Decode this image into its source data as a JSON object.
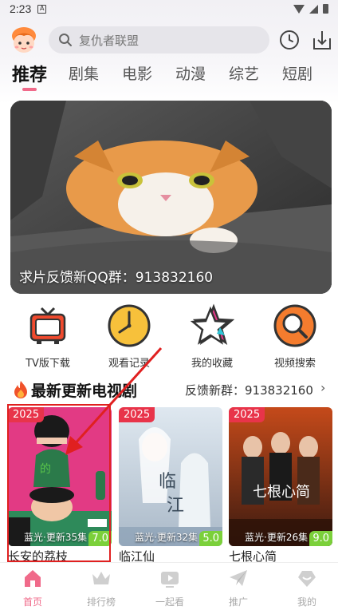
{
  "status_bar": {
    "time": "2:23",
    "notification_icon": "A"
  },
  "search": {
    "placeholder": "复仇者联盟"
  },
  "tabs": [
    {
      "label": "推荐",
      "active": true
    },
    {
      "label": "剧集"
    },
    {
      "label": "电影"
    },
    {
      "label": "动漫"
    },
    {
      "label": "综艺"
    },
    {
      "label": "短剧"
    }
  ],
  "banner": {
    "caption": "求片反馈新QQ群：913832160"
  },
  "shortcuts": [
    {
      "label": "TV版下载",
      "icon": "tv-icon"
    },
    {
      "label": "观看记录",
      "icon": "clock-icon"
    },
    {
      "label": "我的收藏",
      "icon": "star-icon"
    },
    {
      "label": "视频搜索",
      "icon": "magnifier-icon"
    }
  ],
  "section": {
    "title": "最新更新电视剧",
    "link": "反馈新群：913832160",
    "chevron": "›"
  },
  "cards": [
    {
      "year": "2025",
      "update": "蓝光·更新35集",
      "score": "7.0",
      "title": "长安的荔枝"
    },
    {
      "year": "2025",
      "update": "蓝光·更新32集",
      "score": "5.0",
      "title": "临江仙"
    },
    {
      "year": "2025",
      "update": "蓝光·更新26集",
      "score": "9.0",
      "title": "七根心简"
    }
  ],
  "bottom_nav": [
    {
      "label": "首页",
      "icon": "home-icon",
      "active": true
    },
    {
      "label": "排行榜",
      "icon": "crown-icon"
    },
    {
      "label": "一起看",
      "icon": "tv-play-icon"
    },
    {
      "label": "推广",
      "icon": "paper-plane-icon"
    },
    {
      "label": "我的",
      "icon": "profile-icon"
    }
  ],
  "colors": {
    "accent": "#f06a8a",
    "year_badge": "#e8344a",
    "score_badge": "#7bd03a",
    "highlight": "#e02020"
  }
}
